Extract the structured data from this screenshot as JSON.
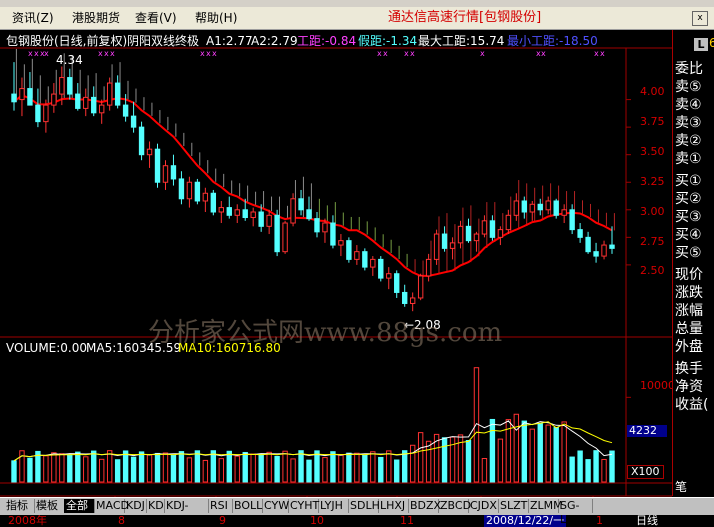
{
  "menu": {
    "items": [
      "资讯(Z)",
      "港股期货",
      "查看(V)",
      "帮助(H)"
    ],
    "title": "通达信高速行情[包钢股份]",
    "win_btn": "x"
  },
  "header": {
    "stock": "包钢股份(日线,前复权)",
    "indicator": "阴阳双线终极",
    "a1": "A1:2.77",
    "a2": "A2:2.79",
    "gongju": "工距:-0.84",
    "jiaju": "假距:-1.34",
    "max_gongju": "最大工距:15.74",
    "min_gongju": "最小工距:-18.50"
  },
  "price_annotations": {
    "high": "4.34",
    "low": "←2.08"
  },
  "watermark": "分析家公式网www.88gs.com",
  "volume_header": {
    "volume": "VOLUME:0.00",
    "ma5": "MA5:160345.59",
    "ma10": "MA10:160716.80"
  },
  "right_panel": [
    "委比",
    "卖⑤",
    "卖④",
    "卖③",
    "卖②",
    "卖①",
    "买①",
    "买②",
    "买③",
    "买④",
    "买⑤",
    "现价",
    "涨跌",
    "涨幅",
    "总量",
    "外盘",
    "换手",
    "净资",
    "收益(",
    "笔"
  ],
  "logo": {
    "L": "L",
    "six": "6"
  },
  "price_axis": [
    "4.00",
    "3.75",
    "3.50",
    "3.25",
    "3.00",
    "2.75",
    "2.50"
  ],
  "volume_axis": {
    "ten_thousand": "10000",
    "current": "4232",
    "multiplier": "X100"
  },
  "date_axis": [
    "2008年",
    "8",
    "9",
    "10",
    "11",
    "2008/12/22/一",
    "1",
    "日线"
  ],
  "tabs": [
    "指标",
    "模板",
    "全部",
    "MACD",
    "KDJ",
    "KD",
    "KDJ-TDX",
    "RSI",
    "BOLL",
    "CYW",
    "CYHT",
    "LYJH",
    "SDLH",
    "LHXJ",
    "BDZX",
    "ZBCD",
    "CJDX",
    "SLZT",
    "ZLMM",
    "SG-LB"
  ],
  "colors": {
    "up": "#ff3232",
    "down": "#54ffff",
    "line_yellow": "#ffff00",
    "line_white": "#ffffff",
    "grid_red": "#a00000",
    "ma_red": "#ff0000"
  },
  "chart_data": {
    "type": "candlestick",
    "price_range": [
      2.0,
      4.45
    ],
    "candles": [
      {
        "o": 4.05,
        "h": 4.34,
        "l": 3.9,
        "c": 3.98
      },
      {
        "o": 4.0,
        "h": 4.2,
        "l": 3.85,
        "c": 4.1
      },
      {
        "o": 4.1,
        "h": 4.25,
        "l": 3.95,
        "c": 3.95
      },
      {
        "o": 3.95,
        "h": 4.1,
        "l": 3.75,
        "c": 3.8
      },
      {
        "o": 3.8,
        "h": 4.0,
        "l": 3.7,
        "c": 3.95
      },
      {
        "o": 3.95,
        "h": 4.15,
        "l": 3.88,
        "c": 4.05
      },
      {
        "o": 4.05,
        "h": 4.3,
        "l": 3.95,
        "c": 4.2
      },
      {
        "o": 4.2,
        "h": 4.28,
        "l": 4.0,
        "c": 4.05
      },
      {
        "o": 4.05,
        "h": 4.15,
        "l": 3.9,
        "c": 3.92
      },
      {
        "o": 3.92,
        "h": 4.1,
        "l": 3.85,
        "c": 4.02
      },
      {
        "o": 4.02,
        "h": 4.12,
        "l": 3.85,
        "c": 3.88
      },
      {
        "o": 3.88,
        "h": 4.0,
        "l": 3.78,
        "c": 3.95
      },
      {
        "o": 3.95,
        "h": 4.2,
        "l": 3.9,
        "c": 4.15
      },
      {
        "o": 4.15,
        "h": 4.22,
        "l": 3.92,
        "c": 3.95
      },
      {
        "o": 3.95,
        "h": 4.05,
        "l": 3.8,
        "c": 3.85
      },
      {
        "o": 3.85,
        "h": 3.98,
        "l": 3.7,
        "c": 3.75
      },
      {
        "o": 3.75,
        "h": 3.8,
        "l": 3.45,
        "c": 3.5
      },
      {
        "o": 3.5,
        "h": 3.62,
        "l": 3.38,
        "c": 3.55
      },
      {
        "o": 3.55,
        "h": 3.6,
        "l": 3.2,
        "c": 3.25
      },
      {
        "o": 3.25,
        "h": 3.45,
        "l": 3.18,
        "c": 3.4
      },
      {
        "o": 3.4,
        "h": 3.5,
        "l": 3.22,
        "c": 3.28
      },
      {
        "o": 3.28,
        "h": 3.35,
        "l": 3.05,
        "c": 3.1
      },
      {
        "o": 3.1,
        "h": 3.3,
        "l": 3.02,
        "c": 3.25
      },
      {
        "o": 3.25,
        "h": 3.28,
        "l": 3.05,
        "c": 3.08
      },
      {
        "o": 3.08,
        "h": 3.2,
        "l": 2.98,
        "c": 3.15
      },
      {
        "o": 3.15,
        "h": 3.18,
        "l": 2.95,
        "c": 2.98
      },
      {
        "o": 2.98,
        "h": 3.08,
        "l": 2.88,
        "c": 3.02
      },
      {
        "o": 3.02,
        "h": 3.12,
        "l": 2.92,
        "c": 2.95
      },
      {
        "o": 2.95,
        "h": 3.05,
        "l": 2.88,
        "c": 3.0
      },
      {
        "o": 3.0,
        "h": 3.1,
        "l": 2.9,
        "c": 2.93
      },
      {
        "o": 2.93,
        "h": 3.02,
        "l": 2.85,
        "c": 2.98
      },
      {
        "o": 2.98,
        "h": 3.05,
        "l": 2.8,
        "c": 2.85
      },
      {
        "o": 2.85,
        "h": 3.0,
        "l": 2.78,
        "c": 2.95
      },
      {
        "o": 2.95,
        "h": 3.0,
        "l": 2.58,
        "c": 2.62
      },
      {
        "o": 2.62,
        "h": 2.9,
        "l": 2.6,
        "c": 2.88
      },
      {
        "o": 2.88,
        "h": 3.15,
        "l": 2.85,
        "c": 3.1
      },
      {
        "o": 3.1,
        "h": 3.18,
        "l": 2.95,
        "c": 3.0
      },
      {
        "o": 3.0,
        "h": 3.12,
        "l": 2.9,
        "c": 2.92
      },
      {
        "o": 2.92,
        "h": 2.98,
        "l": 2.75,
        "c": 2.8
      },
      {
        "o": 2.8,
        "h": 2.92,
        "l": 2.7,
        "c": 2.88
      },
      {
        "o": 2.88,
        "h": 2.95,
        "l": 2.65,
        "c": 2.68
      },
      {
        "o": 2.68,
        "h": 2.78,
        "l": 2.58,
        "c": 2.72
      },
      {
        "o": 2.72,
        "h": 2.75,
        "l": 2.52,
        "c": 2.55
      },
      {
        "o": 2.55,
        "h": 2.68,
        "l": 2.5,
        "c": 2.62
      },
      {
        "o": 2.62,
        "h": 2.65,
        "l": 2.45,
        "c": 2.48
      },
      {
        "o": 2.48,
        "h": 2.58,
        "l": 2.4,
        "c": 2.55
      },
      {
        "o": 2.55,
        "h": 2.58,
        "l": 2.35,
        "c": 2.38
      },
      {
        "o": 2.38,
        "h": 2.48,
        "l": 2.28,
        "c": 2.42
      },
      {
        "o": 2.42,
        "h": 2.45,
        "l": 2.2,
        "c": 2.25
      },
      {
        "o": 2.25,
        "h": 2.32,
        "l": 2.12,
        "c": 2.15
      },
      {
        "o": 2.15,
        "h": 2.25,
        "l": 2.08,
        "c": 2.2
      },
      {
        "o": 2.2,
        "h": 2.42,
        "l": 2.18,
        "c": 2.4
      },
      {
        "o": 2.4,
        "h": 2.6,
        "l": 2.35,
        "c": 2.55
      },
      {
        "o": 2.55,
        "h": 2.82,
        "l": 2.5,
        "c": 2.78
      },
      {
        "o": 2.78,
        "h": 2.85,
        "l": 2.62,
        "c": 2.65
      },
      {
        "o": 2.65,
        "h": 2.75,
        "l": 2.55,
        "c": 2.7
      },
      {
        "o": 2.7,
        "h": 2.9,
        "l": 2.65,
        "c": 2.85
      },
      {
        "o": 2.85,
        "h": 2.92,
        "l": 2.7,
        "c": 2.72
      },
      {
        "o": 2.72,
        "h": 2.8,
        "l": 2.62,
        "c": 2.78
      },
      {
        "o": 2.78,
        "h": 2.95,
        "l": 2.75,
        "c": 2.9
      },
      {
        "o": 2.9,
        "h": 2.95,
        "l": 2.72,
        "c": 2.75
      },
      {
        "o": 2.75,
        "h": 2.85,
        "l": 2.68,
        "c": 2.82
      },
      {
        "o": 2.82,
        "h": 3.0,
        "l": 2.78,
        "c": 2.95
      },
      {
        "o": 2.95,
        "h": 3.15,
        "l": 2.9,
        "c": 3.08
      },
      {
        "o": 3.08,
        "h": 3.12,
        "l": 2.92,
        "c": 2.98
      },
      {
        "o": 2.98,
        "h": 3.08,
        "l": 2.9,
        "c": 3.05
      },
      {
        "o": 3.05,
        "h": 3.1,
        "l": 2.95,
        "c": 3.0
      },
      {
        "o": 3.0,
        "h": 3.12,
        "l": 2.96,
        "c": 3.08
      },
      {
        "o": 3.08,
        "h": 3.1,
        "l": 2.92,
        "c": 2.95
      },
      {
        "o": 2.95,
        "h": 3.05,
        "l": 2.88,
        "c": 3.0
      },
      {
        "o": 3.0,
        "h": 3.05,
        "l": 2.78,
        "c": 2.82
      },
      {
        "o": 2.82,
        "h": 2.88,
        "l": 2.7,
        "c": 2.75
      },
      {
        "o": 2.75,
        "h": 2.8,
        "l": 2.6,
        "c": 2.62
      },
      {
        "o": 2.62,
        "h": 2.7,
        "l": 2.52,
        "c": 2.58
      },
      {
        "o": 2.58,
        "h": 2.72,
        "l": 2.55,
        "c": 2.68
      },
      {
        "o": 2.68,
        "h": 2.85,
        "l": 2.6,
        "c": 2.65
      }
    ],
    "volume_ylim": [
      0,
      15000
    ]
  }
}
